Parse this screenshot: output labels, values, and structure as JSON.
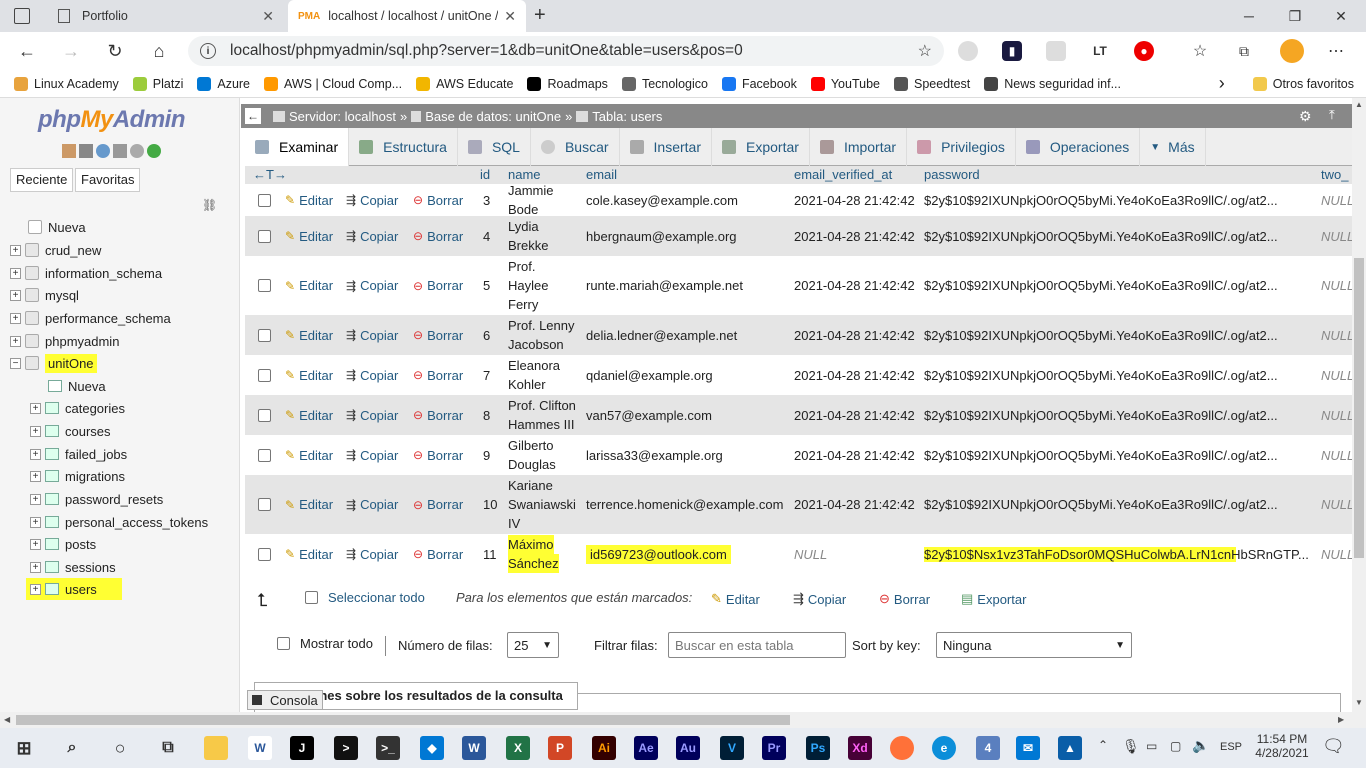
{
  "browser": {
    "tabs": [
      {
        "title": "Portfolio",
        "active": false
      },
      {
        "title": "localhost / localhost / unitOne / ",
        "active": true
      }
    ],
    "url": "localhost/phpmyadmin/sql.php?server=1&db=unitOne&table=users&pos=0",
    "bookmarks": [
      "Linux Academy",
      "Platzi",
      "Azure",
      "AWS | Cloud Comp...",
      "AWS Educate",
      "Roadmaps",
      "Tecnologico",
      "Facebook",
      "YouTube",
      "Speedtest",
      "News seguridad inf..."
    ],
    "other_bookmarks": "Otros favoritos"
  },
  "pma": {
    "logo": {
      "php": "php",
      "my": "My",
      "admin": "Admin"
    },
    "left_buttons": [
      "Reciente",
      "Favoritas"
    ],
    "tree": {
      "new": "Nueva",
      "databases": [
        "crud_new",
        "information_schema",
        "mysql",
        "performance_schema",
        "phpmyadmin",
        "unitOne"
      ],
      "unitone_new": "Nueva",
      "tables": [
        "categories",
        "courses",
        "failed_jobs",
        "migrations",
        "password_resets",
        "personal_access_tokens",
        "posts",
        "sessions",
        "users"
      ]
    },
    "breadcrumb": {
      "server": "Servidor: localhost",
      "db": "Base de datos: unitOne",
      "table": "Tabla: users"
    },
    "tabs": [
      "Examinar",
      "Estructura",
      "SQL",
      "Buscar",
      "Insertar",
      "Exportar",
      "Importar",
      "Privilegios",
      "Operaciones",
      "Más"
    ],
    "columns": [
      "id",
      "name",
      "email",
      "email_verified_at",
      "password",
      "two_"
    ],
    "actions": {
      "edit": "Editar",
      "copy": "Copiar",
      "delete": "Borrar"
    },
    "rows": [
      {
        "id": "3",
        "name": [
          "Jammie",
          "Bode"
        ],
        "email": "cole.kasey@example.com",
        "verified": "2021-04-28 21:42:42",
        "password": "$2y$10$92IXUNpkjO0rOQ5byMi.Ye4oKoEa3Ro9llC/.og/at2...",
        "two": "NULL"
      },
      {
        "id": "4",
        "name": [
          "Lydia",
          "Brekke"
        ],
        "email": "hbergnaum@example.org",
        "verified": "2021-04-28 21:42:42",
        "password": "$2y$10$92IXUNpkjO0rOQ5byMi.Ye4oKoEa3Ro9llC/.og/at2...",
        "two": "NULL"
      },
      {
        "id": "5",
        "name": [
          "Prof.",
          "Haylee",
          "Ferry"
        ],
        "email": "runte.mariah@example.net",
        "verified": "2021-04-28 21:42:42",
        "password": "$2y$10$92IXUNpkjO0rOQ5byMi.Ye4oKoEa3Ro9llC/.og/at2...",
        "two": "NULL"
      },
      {
        "id": "6",
        "name": [
          "Prof. Lenny",
          "Jacobson"
        ],
        "email": "delia.ledner@example.net",
        "verified": "2021-04-28 21:42:42",
        "password": "$2y$10$92IXUNpkjO0rOQ5byMi.Ye4oKoEa3Ro9llC/.og/at2...",
        "two": "NULL"
      },
      {
        "id": "7",
        "name": [
          "Eleanora",
          "Kohler"
        ],
        "email": "qdaniel@example.org",
        "verified": "2021-04-28 21:42:42",
        "password": "$2y$10$92IXUNpkjO0rOQ5byMi.Ye4oKoEa3Ro9llC/.og/at2...",
        "two": "NULL"
      },
      {
        "id": "8",
        "name": [
          "Prof. Clifton",
          "Hammes III"
        ],
        "email": "van57@example.com",
        "verified": "2021-04-28 21:42:42",
        "password": "$2y$10$92IXUNpkjO0rOQ5byMi.Ye4oKoEa3Ro9llC/.og/at2...",
        "two": "NULL"
      },
      {
        "id": "9",
        "name": [
          "Gilberto",
          "Douglas"
        ],
        "email": "larissa33@example.org",
        "verified": "2021-04-28 21:42:42",
        "password": "$2y$10$92IXUNpkjO0rOQ5byMi.Ye4oKoEa3Ro9llC/.og/at2...",
        "two": "NULL"
      },
      {
        "id": "10",
        "name": [
          "Kariane",
          "Swaniawski",
          "IV"
        ],
        "email": "terrence.homenick@example.com",
        "verified": "2021-04-28 21:42:42",
        "password": "$2y$10$92IXUNpkjO0rOQ5byMi.Ye4oKoEa3Ro9llC/.og/at2...",
        "two": "NULL"
      },
      {
        "id": "11",
        "name": [
          "Máximo",
          "Sánchez"
        ],
        "email": "id569723@outlook.com",
        "verified": "NULL",
        "password": "$2y$10$Nsx1vz3TahFoDsor0MQSHuColwbA.LrN1cnHbSRnGTP...",
        "two": "NULL"
      }
    ],
    "bulk": {
      "select_all": "Seleccionar todo",
      "marked_label": "Para los elementos que están marcados:",
      "edit": "Editar",
      "copy": "Copiar",
      "delete": "Borrar",
      "export": "Exportar"
    },
    "nav": {
      "show_all": "Mostrar todo",
      "rows_label": "Número de filas:",
      "rows_value": "25",
      "filter_label": "Filtrar filas:",
      "filter_placeholder": "Buscar en esta tabla",
      "sort_label": "Sort by key:",
      "sort_value": "Ninguna"
    },
    "ops_title": "Operaciones sobre los resultados de la consulta",
    "console": "Consola"
  },
  "taskbar": {
    "time": "11:54 PM",
    "date": "4/28/2021",
    "lang": "ESP"
  }
}
